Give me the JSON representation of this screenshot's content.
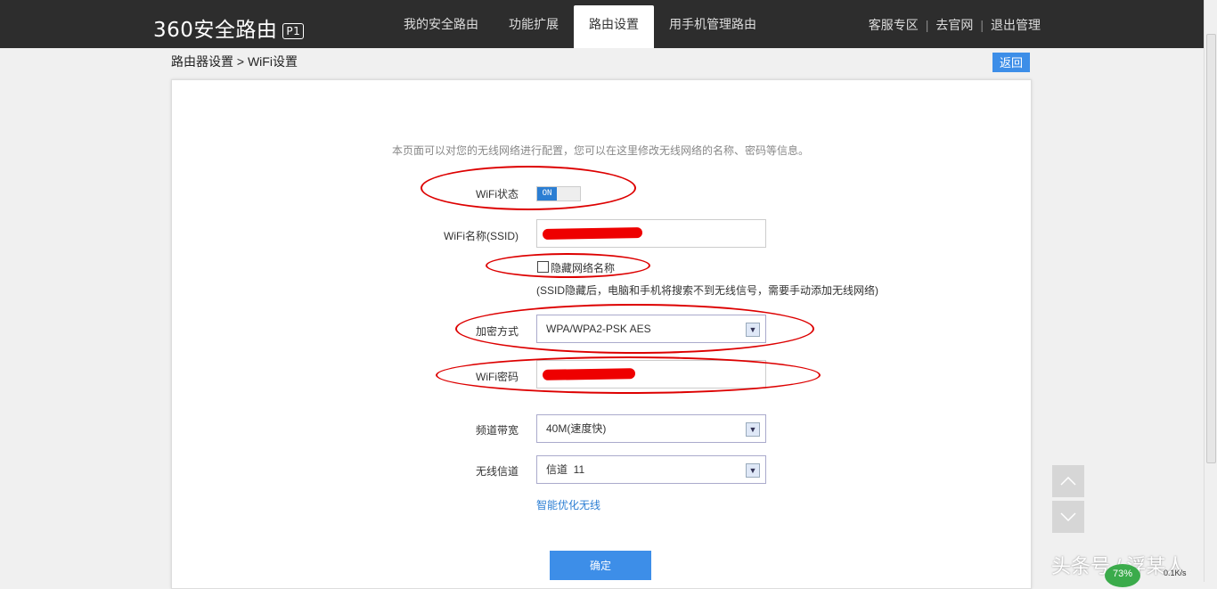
{
  "header": {
    "logo": "360安全路由",
    "model": "P1",
    "tabs": [
      "我的安全路由",
      "功能扩展",
      "路由设置",
      "用手机管理路由"
    ],
    "active_tab": "路由设置",
    "links": [
      "客服专区",
      "去官网",
      "退出管理"
    ],
    "link_separator": "|"
  },
  "breadcrumb": "路由器设置 > WiFi设置",
  "back_button": "返回",
  "form": {
    "description": "本页面可以对您的无线网络进行配置，您可以在这里修改无线网络的名称、密码等信息。",
    "wifi_status_label": "WiFi状态",
    "wifi_status_value": "ON",
    "ssid_label": "WiFi名称(SSID)",
    "hide_ssid_label": "隐藏网络名称",
    "hide_ssid_hint": "(SSID隐藏后，电脑和手机将搜索不到无线信号，需要手动添加无线网络)",
    "encryption_label": "加密方式",
    "encryption_value": "WPA/WPA2-PSK AES",
    "password_label": "WiFi密码",
    "bandwidth_label": "频道带宽",
    "bandwidth_value": "40M(速度快)",
    "channel_label": "无线信道",
    "channel_value": "信道  11",
    "optimize_link": "智能优化无线",
    "confirm_button": "确定"
  },
  "overlay": {
    "watermark": "头条号 / 浮某人",
    "speed_percent": "73%",
    "net_rate": "0.1K/s"
  },
  "colors": {
    "accent": "#3d8ee8",
    "topbar": "#2d2d2d",
    "annotation": "#dd0000"
  }
}
